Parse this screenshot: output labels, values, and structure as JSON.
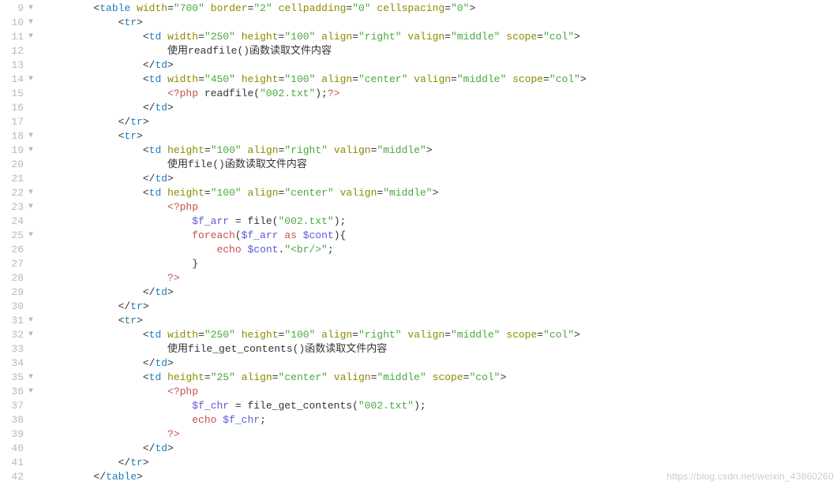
{
  "watermark": "https://blog.csdn.net/weixin_43860260",
  "lines": [
    {
      "n": 9,
      "fold": true,
      "indent": 2,
      "tokens": [
        {
          "t": "<",
          "c": "punc"
        },
        {
          "t": "table",
          "c": "tag"
        },
        {
          "t": " ",
          "c": "punc"
        },
        {
          "t": "width",
          "c": "attr"
        },
        {
          "t": "=",
          "c": "punc"
        },
        {
          "t": "\"700\"",
          "c": "str"
        },
        {
          "t": " ",
          "c": "punc"
        },
        {
          "t": "border",
          "c": "attr"
        },
        {
          "t": "=",
          "c": "punc"
        },
        {
          "t": "\"2\"",
          "c": "str"
        },
        {
          "t": " ",
          "c": "punc"
        },
        {
          "t": "cellpadding",
          "c": "attr"
        },
        {
          "t": "=",
          "c": "punc"
        },
        {
          "t": "\"0\"",
          "c": "str"
        },
        {
          "t": " ",
          "c": "punc"
        },
        {
          "t": "cellspacing",
          "c": "attr"
        },
        {
          "t": "=",
          "c": "punc"
        },
        {
          "t": "\"0\"",
          "c": "str"
        },
        {
          "t": ">",
          "c": "punc"
        }
      ]
    },
    {
      "n": 10,
      "fold": true,
      "indent": 3,
      "tokens": [
        {
          "t": "<",
          "c": "punc"
        },
        {
          "t": "tr",
          "c": "tag"
        },
        {
          "t": ">",
          "c": "punc"
        }
      ]
    },
    {
      "n": 11,
      "fold": true,
      "indent": 4,
      "tokens": [
        {
          "t": "<",
          "c": "punc"
        },
        {
          "t": "td",
          "c": "tag"
        },
        {
          "t": " ",
          "c": "punc"
        },
        {
          "t": "width",
          "c": "attr"
        },
        {
          "t": "=",
          "c": "punc"
        },
        {
          "t": "\"250\"",
          "c": "str"
        },
        {
          "t": " ",
          "c": "punc"
        },
        {
          "t": "height",
          "c": "attr"
        },
        {
          "t": "=",
          "c": "punc"
        },
        {
          "t": "\"100\"",
          "c": "str"
        },
        {
          "t": " ",
          "c": "punc"
        },
        {
          "t": "align",
          "c": "attr"
        },
        {
          "t": "=",
          "c": "punc"
        },
        {
          "t": "\"right\"",
          "c": "str"
        },
        {
          "t": " ",
          "c": "punc"
        },
        {
          "t": "valign",
          "c": "attr"
        },
        {
          "t": "=",
          "c": "punc"
        },
        {
          "t": "\"middle\"",
          "c": "str"
        },
        {
          "t": " ",
          "c": "punc"
        },
        {
          "t": "scope",
          "c": "attr"
        },
        {
          "t": "=",
          "c": "punc"
        },
        {
          "t": "\"col\"",
          "c": "str"
        },
        {
          "t": ">",
          "c": "punc"
        }
      ]
    },
    {
      "n": 12,
      "fold": false,
      "indent": 5,
      "tokens": [
        {
          "t": "使用readfile()函数读取文件内容",
          "c": "txt"
        }
      ]
    },
    {
      "n": 13,
      "fold": false,
      "indent": 4,
      "tokens": [
        {
          "t": "</",
          "c": "punc"
        },
        {
          "t": "td",
          "c": "tag"
        },
        {
          "t": ">",
          "c": "punc"
        }
      ]
    },
    {
      "n": 14,
      "fold": true,
      "indent": 4,
      "tokens": [
        {
          "t": "<",
          "c": "punc"
        },
        {
          "t": "td",
          "c": "tag"
        },
        {
          "t": " ",
          "c": "punc"
        },
        {
          "t": "width",
          "c": "attr"
        },
        {
          "t": "=",
          "c": "punc"
        },
        {
          "t": "\"450\"",
          "c": "str"
        },
        {
          "t": " ",
          "c": "punc"
        },
        {
          "t": "height",
          "c": "attr"
        },
        {
          "t": "=",
          "c": "punc"
        },
        {
          "t": "\"100\"",
          "c": "str"
        },
        {
          "t": " ",
          "c": "punc"
        },
        {
          "t": "align",
          "c": "attr"
        },
        {
          "t": "=",
          "c": "punc"
        },
        {
          "t": "\"center\"",
          "c": "str"
        },
        {
          "t": " ",
          "c": "punc"
        },
        {
          "t": "valign",
          "c": "attr"
        },
        {
          "t": "=",
          "c": "punc"
        },
        {
          "t": "\"middle\"",
          "c": "str"
        },
        {
          "t": " ",
          "c": "punc"
        },
        {
          "t": "scope",
          "c": "attr"
        },
        {
          "t": "=",
          "c": "punc"
        },
        {
          "t": "\"col\"",
          "c": "str"
        },
        {
          "t": ">",
          "c": "punc"
        }
      ]
    },
    {
      "n": 15,
      "fold": false,
      "indent": 5,
      "tokens": [
        {
          "t": "<?php",
          "c": "php"
        },
        {
          "t": " readfile(",
          "c": "txt"
        },
        {
          "t": "\"002.txt\"",
          "c": "str"
        },
        {
          "t": ");",
          "c": "txt"
        },
        {
          "t": "?>",
          "c": "php"
        }
      ]
    },
    {
      "n": 16,
      "fold": false,
      "indent": 4,
      "tokens": [
        {
          "t": "</",
          "c": "punc"
        },
        {
          "t": "td",
          "c": "tag"
        },
        {
          "t": ">",
          "c": "punc"
        }
      ]
    },
    {
      "n": 17,
      "fold": false,
      "indent": 3,
      "tokens": [
        {
          "t": "</",
          "c": "punc"
        },
        {
          "t": "tr",
          "c": "tag"
        },
        {
          "t": ">",
          "c": "punc"
        }
      ]
    },
    {
      "n": 18,
      "fold": true,
      "indent": 3,
      "tokens": [
        {
          "t": "<",
          "c": "punc"
        },
        {
          "t": "tr",
          "c": "tag"
        },
        {
          "t": ">",
          "c": "punc"
        }
      ]
    },
    {
      "n": 19,
      "fold": true,
      "indent": 4,
      "tokens": [
        {
          "t": "<",
          "c": "punc"
        },
        {
          "t": "td",
          "c": "tag"
        },
        {
          "t": " ",
          "c": "punc"
        },
        {
          "t": "height",
          "c": "attr"
        },
        {
          "t": "=",
          "c": "punc"
        },
        {
          "t": "\"100\"",
          "c": "str"
        },
        {
          "t": " ",
          "c": "punc"
        },
        {
          "t": "align",
          "c": "attr"
        },
        {
          "t": "=",
          "c": "punc"
        },
        {
          "t": "\"right\"",
          "c": "str"
        },
        {
          "t": " ",
          "c": "punc"
        },
        {
          "t": "valign",
          "c": "attr"
        },
        {
          "t": "=",
          "c": "punc"
        },
        {
          "t": "\"middle\"",
          "c": "str"
        },
        {
          "t": ">",
          "c": "punc"
        }
      ]
    },
    {
      "n": 20,
      "fold": false,
      "indent": 5,
      "tokens": [
        {
          "t": "使用file()函数读取文件内容",
          "c": "txt"
        }
      ]
    },
    {
      "n": 21,
      "fold": false,
      "indent": 4,
      "tokens": [
        {
          "t": "</",
          "c": "punc"
        },
        {
          "t": "td",
          "c": "tag"
        },
        {
          "t": ">",
          "c": "punc"
        }
      ]
    },
    {
      "n": 22,
      "fold": true,
      "indent": 4,
      "tokens": [
        {
          "t": "<",
          "c": "punc"
        },
        {
          "t": "td",
          "c": "tag"
        },
        {
          "t": " ",
          "c": "punc"
        },
        {
          "t": "height",
          "c": "attr"
        },
        {
          "t": "=",
          "c": "punc"
        },
        {
          "t": "\"100\"",
          "c": "str"
        },
        {
          "t": " ",
          "c": "punc"
        },
        {
          "t": "align",
          "c": "attr"
        },
        {
          "t": "=",
          "c": "punc"
        },
        {
          "t": "\"center\"",
          "c": "str"
        },
        {
          "t": " ",
          "c": "punc"
        },
        {
          "t": "valign",
          "c": "attr"
        },
        {
          "t": "=",
          "c": "punc"
        },
        {
          "t": "\"middle\"",
          "c": "str"
        },
        {
          "t": ">",
          "c": "punc"
        }
      ]
    },
    {
      "n": 23,
      "fold": true,
      "indent": 5,
      "tokens": [
        {
          "t": "<?php",
          "c": "php"
        }
      ]
    },
    {
      "n": 24,
      "fold": false,
      "indent": 6,
      "tokens": [
        {
          "t": "$f_arr",
          "c": "var"
        },
        {
          "t": " = file(",
          "c": "txt"
        },
        {
          "t": "\"002.txt\"",
          "c": "str"
        },
        {
          "t": ");",
          "c": "txt"
        }
      ]
    },
    {
      "n": 25,
      "fold": true,
      "indent": 6,
      "tokens": [
        {
          "t": "foreach",
          "c": "kw"
        },
        {
          "t": "(",
          "c": "txt"
        },
        {
          "t": "$f_arr",
          "c": "var"
        },
        {
          "t": " ",
          "c": "txt"
        },
        {
          "t": "as",
          "c": "kw"
        },
        {
          "t": " ",
          "c": "txt"
        },
        {
          "t": "$cont",
          "c": "var"
        },
        {
          "t": "){",
          "c": "txt"
        }
      ]
    },
    {
      "n": 26,
      "fold": false,
      "indent": 7,
      "tokens": [
        {
          "t": "echo",
          "c": "kw"
        },
        {
          "t": " ",
          "c": "txt"
        },
        {
          "t": "$cont",
          "c": "var"
        },
        {
          "t": ".",
          "c": "txt"
        },
        {
          "t": "\"<br/>\"",
          "c": "str"
        },
        {
          "t": ";",
          "c": "txt"
        }
      ]
    },
    {
      "n": 27,
      "fold": false,
      "indent": 6,
      "tokens": [
        {
          "t": "}",
          "c": "txt"
        }
      ]
    },
    {
      "n": 28,
      "fold": false,
      "indent": 5,
      "tokens": [
        {
          "t": "?>",
          "c": "php"
        }
      ]
    },
    {
      "n": 29,
      "fold": false,
      "indent": 4,
      "tokens": [
        {
          "t": "</",
          "c": "punc"
        },
        {
          "t": "td",
          "c": "tag"
        },
        {
          "t": ">",
          "c": "punc"
        }
      ]
    },
    {
      "n": 30,
      "fold": false,
      "indent": 3,
      "tokens": [
        {
          "t": "</",
          "c": "punc"
        },
        {
          "t": "tr",
          "c": "tag"
        },
        {
          "t": ">",
          "c": "punc"
        }
      ]
    },
    {
      "n": 31,
      "fold": true,
      "indent": 3,
      "tokens": [
        {
          "t": "<",
          "c": "punc"
        },
        {
          "t": "tr",
          "c": "tag"
        },
        {
          "t": ">",
          "c": "punc"
        }
      ]
    },
    {
      "n": 32,
      "fold": true,
      "indent": 4,
      "tokens": [
        {
          "t": "<",
          "c": "punc"
        },
        {
          "t": "td",
          "c": "tag"
        },
        {
          "t": " ",
          "c": "punc"
        },
        {
          "t": "width",
          "c": "attr"
        },
        {
          "t": "=",
          "c": "punc"
        },
        {
          "t": "\"250\"",
          "c": "str"
        },
        {
          "t": " ",
          "c": "punc"
        },
        {
          "t": "height",
          "c": "attr"
        },
        {
          "t": "=",
          "c": "punc"
        },
        {
          "t": "\"100\"",
          "c": "str"
        },
        {
          "t": " ",
          "c": "punc"
        },
        {
          "t": "align",
          "c": "attr"
        },
        {
          "t": "=",
          "c": "punc"
        },
        {
          "t": "\"right\"",
          "c": "str"
        },
        {
          "t": " ",
          "c": "punc"
        },
        {
          "t": "valign",
          "c": "attr"
        },
        {
          "t": "=",
          "c": "punc"
        },
        {
          "t": "\"middle\"",
          "c": "str"
        },
        {
          "t": " ",
          "c": "punc"
        },
        {
          "t": "scope",
          "c": "attr"
        },
        {
          "t": "=",
          "c": "punc"
        },
        {
          "t": "\"col\"",
          "c": "str"
        },
        {
          "t": ">",
          "c": "punc"
        }
      ]
    },
    {
      "n": 33,
      "fold": false,
      "indent": 5,
      "tokens": [
        {
          "t": "使用file_get_contents()函数读取文件内容",
          "c": "txt"
        }
      ]
    },
    {
      "n": 34,
      "fold": false,
      "indent": 4,
      "tokens": [
        {
          "t": "</",
          "c": "punc"
        },
        {
          "t": "td",
          "c": "tag"
        },
        {
          "t": ">",
          "c": "punc"
        }
      ]
    },
    {
      "n": 35,
      "fold": true,
      "indent": 4,
      "tokens": [
        {
          "t": "<",
          "c": "punc"
        },
        {
          "t": "td",
          "c": "tag"
        },
        {
          "t": " ",
          "c": "punc"
        },
        {
          "t": "height",
          "c": "attr"
        },
        {
          "t": "=",
          "c": "punc"
        },
        {
          "t": "\"25\"",
          "c": "str"
        },
        {
          "t": " ",
          "c": "punc"
        },
        {
          "t": "align",
          "c": "attr"
        },
        {
          "t": "=",
          "c": "punc"
        },
        {
          "t": "\"center\"",
          "c": "str"
        },
        {
          "t": " ",
          "c": "punc"
        },
        {
          "t": "valign",
          "c": "attr"
        },
        {
          "t": "=",
          "c": "punc"
        },
        {
          "t": "\"middle\"",
          "c": "str"
        },
        {
          "t": " ",
          "c": "punc"
        },
        {
          "t": "scope",
          "c": "attr"
        },
        {
          "t": "=",
          "c": "punc"
        },
        {
          "t": "\"col\"",
          "c": "str"
        },
        {
          "t": ">",
          "c": "punc"
        }
      ]
    },
    {
      "n": 36,
      "fold": true,
      "indent": 5,
      "tokens": [
        {
          "t": "<?php",
          "c": "php"
        }
      ]
    },
    {
      "n": 37,
      "fold": false,
      "indent": 6,
      "tokens": [
        {
          "t": "$f_chr",
          "c": "var"
        },
        {
          "t": " = file_get_contents(",
          "c": "txt"
        },
        {
          "t": "\"002.txt\"",
          "c": "str"
        },
        {
          "t": ");",
          "c": "txt"
        }
      ]
    },
    {
      "n": 38,
      "fold": false,
      "indent": 6,
      "tokens": [
        {
          "t": "echo",
          "c": "kw"
        },
        {
          "t": " ",
          "c": "txt"
        },
        {
          "t": "$f_chr",
          "c": "var"
        },
        {
          "t": ";",
          "c": "txt"
        }
      ]
    },
    {
      "n": 39,
      "fold": false,
      "indent": 5,
      "tokens": [
        {
          "t": "?>",
          "c": "php"
        }
      ]
    },
    {
      "n": 40,
      "fold": false,
      "indent": 4,
      "tokens": [
        {
          "t": "</",
          "c": "punc"
        },
        {
          "t": "td",
          "c": "tag"
        },
        {
          "t": ">",
          "c": "punc"
        }
      ]
    },
    {
      "n": 41,
      "fold": false,
      "indent": 3,
      "tokens": [
        {
          "t": "</",
          "c": "punc"
        },
        {
          "t": "tr",
          "c": "tag"
        },
        {
          "t": ">",
          "c": "punc"
        }
      ]
    },
    {
      "n": 42,
      "fold": false,
      "indent": 2,
      "tokens": [
        {
          "t": "</",
          "c": "punc"
        },
        {
          "t": "table",
          "c": "tag"
        },
        {
          "t": ">",
          "c": "punc"
        }
      ]
    }
  ]
}
